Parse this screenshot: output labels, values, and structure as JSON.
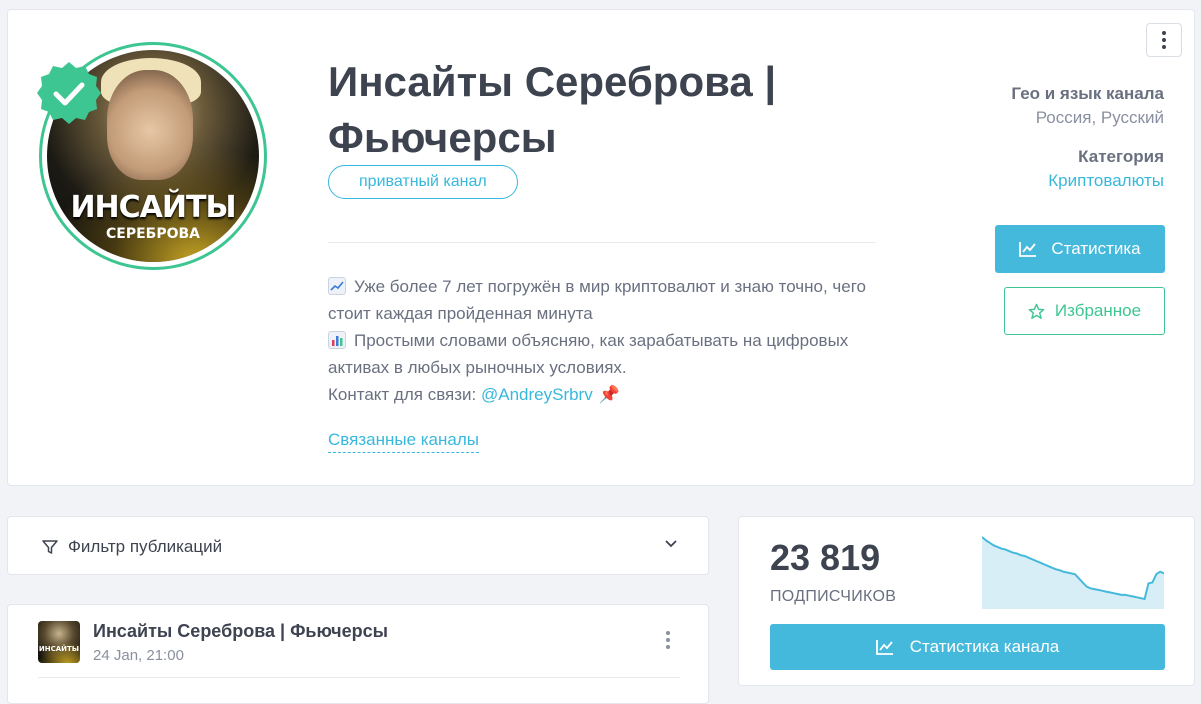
{
  "channel": {
    "title": "Инсайты Сереброва | Фьючерсы",
    "avatar_text_main": "ИНСАЙТЫ",
    "avatar_text_sub": "СЕРЕБРОВА",
    "privacy_badge": "приватный канал",
    "description": {
      "line1": "Уже более 7 лет погружён в мир криптовалют и знаю точно, чего стоит каждая пройденная минута",
      "line2": "Простыми словами объясняю, как зарабатывать на цифровых активах в любых рыночных условиях.",
      "contact_prefix": "Контакт для связи: ",
      "contact_handle": "@AndreySrbrv"
    },
    "related_link": "Связанные каналы"
  },
  "meta": {
    "geo_label": "Гео и язык канала",
    "geo_value": "Россия, Русский",
    "category_label": "Категория",
    "category_value": "Криптовалюты"
  },
  "actions": {
    "stats_label": "Статистика",
    "favorite_label": "Избранное"
  },
  "filter": {
    "label": "Фильтр публикаций"
  },
  "post": {
    "channel_name": "Инсайты Сереброва | Фьючерсы",
    "date": "24 Jan, 21:00",
    "avatar_text": "ИНСАЙТЫ"
  },
  "subscribers": {
    "count": "23 819",
    "label": "ПОДПИСЧИКОВ",
    "button_label": "Статистика канала",
    "trend": [
      100,
      96,
      93,
      90,
      88,
      86,
      85,
      83,
      81,
      80,
      78,
      77,
      75,
      73,
      71,
      69,
      67,
      65,
      63,
      61,
      60,
      58,
      57,
      56,
      55,
      50,
      45,
      40,
      38,
      37,
      36,
      35,
      34,
      33,
      32,
      31,
      30,
      30,
      29,
      28,
      27,
      26,
      25,
      44,
      45,
      55,
      58,
      56
    ]
  },
  "colors": {
    "accent": "#45b9dc",
    "green": "#3ec692",
    "text": "#3e4350",
    "muted": "#8a90a0"
  },
  "icons": {
    "menu": "vertical-dots-icon",
    "verified": "verified-check-icon",
    "stats": "line-chart-icon",
    "favorite": "star-icon",
    "filter": "filter-icon",
    "chevron": "chevron-down-icon",
    "pin": "pushpin-icon"
  }
}
